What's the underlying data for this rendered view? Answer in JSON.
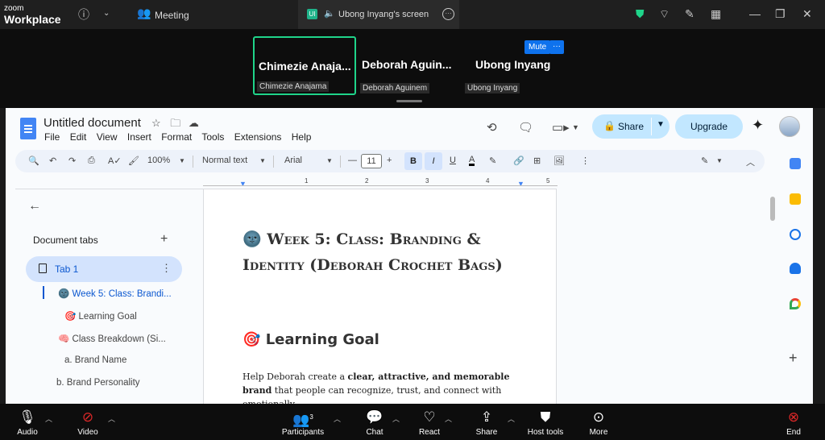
{
  "zoom": {
    "logo_line1": "zoom",
    "logo_line2": "Workplace",
    "meeting_label": "Meeting",
    "screen_tab_label": "Ubong Inyang's screen",
    "ui_badge": "UI"
  },
  "participants_strip": [
    {
      "big": "Chimezie  Anaja...",
      "small": "Chimezie Anajama",
      "active": true
    },
    {
      "big": "Deborah  Aguin...",
      "small": "Deborah Aguinem",
      "active": false
    },
    {
      "big": "Ubong Inyang",
      "small": "Ubong Inyang",
      "active": false
    }
  ],
  "mute_label": "Mute",
  "more_label": "···",
  "docs": {
    "title": "Untitled document",
    "menu": [
      "File",
      "Edit",
      "View",
      "Insert",
      "Format",
      "Tools",
      "Extensions",
      "Help"
    ],
    "share_label": "Share",
    "upgrade_label": "Upgrade",
    "toolbar": {
      "zoom": "100%",
      "style": "Normal text",
      "font": "Arial",
      "font_size": "11",
      "bold": "B",
      "italic": "I",
      "underline": "U",
      "color": "A"
    },
    "ruler_numbers": [
      "1",
      "2",
      "3",
      "4",
      "5"
    ],
    "panel_title": "Document tabs",
    "tab1_label": "Tab 1",
    "outline": [
      {
        "text": "Week 5: Class: Brandi...",
        "emoji": "🌚",
        "active": true
      },
      {
        "text": "Learning Goal",
        "emoji": "🎯",
        "active": false
      },
      {
        "text": "Class Breakdown (Si...",
        "emoji": "🧠",
        "active": false
      },
      {
        "text": "a. Brand Name",
        "emoji": "",
        "active": false
      },
      {
        "text": "b. Brand Personality",
        "emoji": "",
        "active": false
      }
    ],
    "heading_emoji": "🌚",
    "heading": "Week 5: Class: Branding & Identity (Deborah Crochet Bags)",
    "learning_emoji": "🎯",
    "learning_heading": "Learning Goal",
    "para_pre": "Help Deborah create a ",
    "para_bold": "clear, attractive, and memorable brand",
    "para_post": " that people can recognize, trust, and connect with emotionally."
  },
  "bottom_bar": {
    "audio": "Audio",
    "video": "Video",
    "participants": "Participants",
    "participants_count": "3",
    "chat": "Chat",
    "react": "React",
    "share": "Share",
    "host_tools": "Host tools",
    "more": "More",
    "end": "End"
  },
  "colors": {
    "zoom_green": "#1fd48a",
    "zoom_blue": "#0e72ed",
    "docs_blue": "#0b57d0",
    "share_bg": "#c2e7ff",
    "end_red": "#e02828"
  }
}
